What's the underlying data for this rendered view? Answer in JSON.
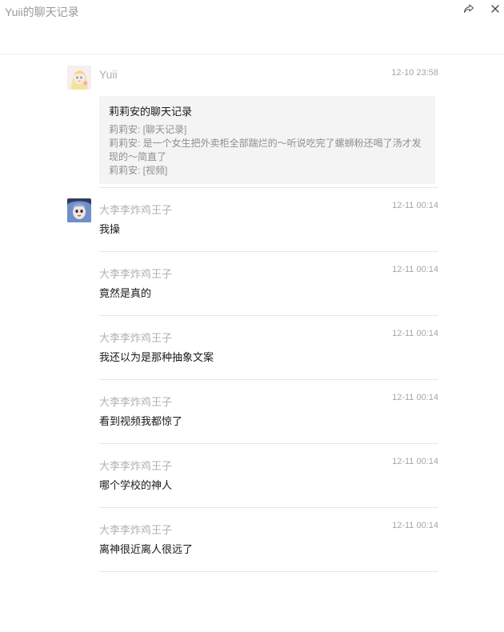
{
  "window": {
    "title": "Yuii的聊天记录",
    "share_icon": "share-icon",
    "close_icon": "close-icon"
  },
  "first_message": {
    "sender": "Yuii",
    "time": "12-10 23:58",
    "avatar": "anime-avatar-blonde",
    "card": {
      "title": "莉莉安的聊天记录",
      "lines": [
        "莉莉安: [聊天记录]",
        "莉莉安: 是一个女生把外卖柜全部踹烂的～听说吃完了螺蛳粉还喝了汤才发",
        "现的～简直了",
        "莉莉安: [视频]"
      ]
    }
  },
  "messages": [
    {
      "sender": "大李李炸鸡王子",
      "time": "12-11 00:14",
      "text": "我操",
      "avatar": "anime-avatar-blue-hair"
    },
    {
      "sender": "大李李炸鸡王子",
      "time": "12-11 00:14",
      "text": "竟然是真的"
    },
    {
      "sender": "大李李炸鸡王子",
      "time": "12-11 00:14",
      "text": "我还以为是那种抽象文案"
    },
    {
      "sender": "大李李炸鸡王子",
      "time": "12-11 00:14",
      "text": "看到视频我都惊了"
    },
    {
      "sender": "大李李炸鸡王子",
      "time": "12-11 00:14",
      "text": "哪个学校的神人"
    },
    {
      "sender": "大李李炸鸡王子",
      "time": "12-11 00:14",
      "text": "离神很近离人很远了"
    }
  ]
}
